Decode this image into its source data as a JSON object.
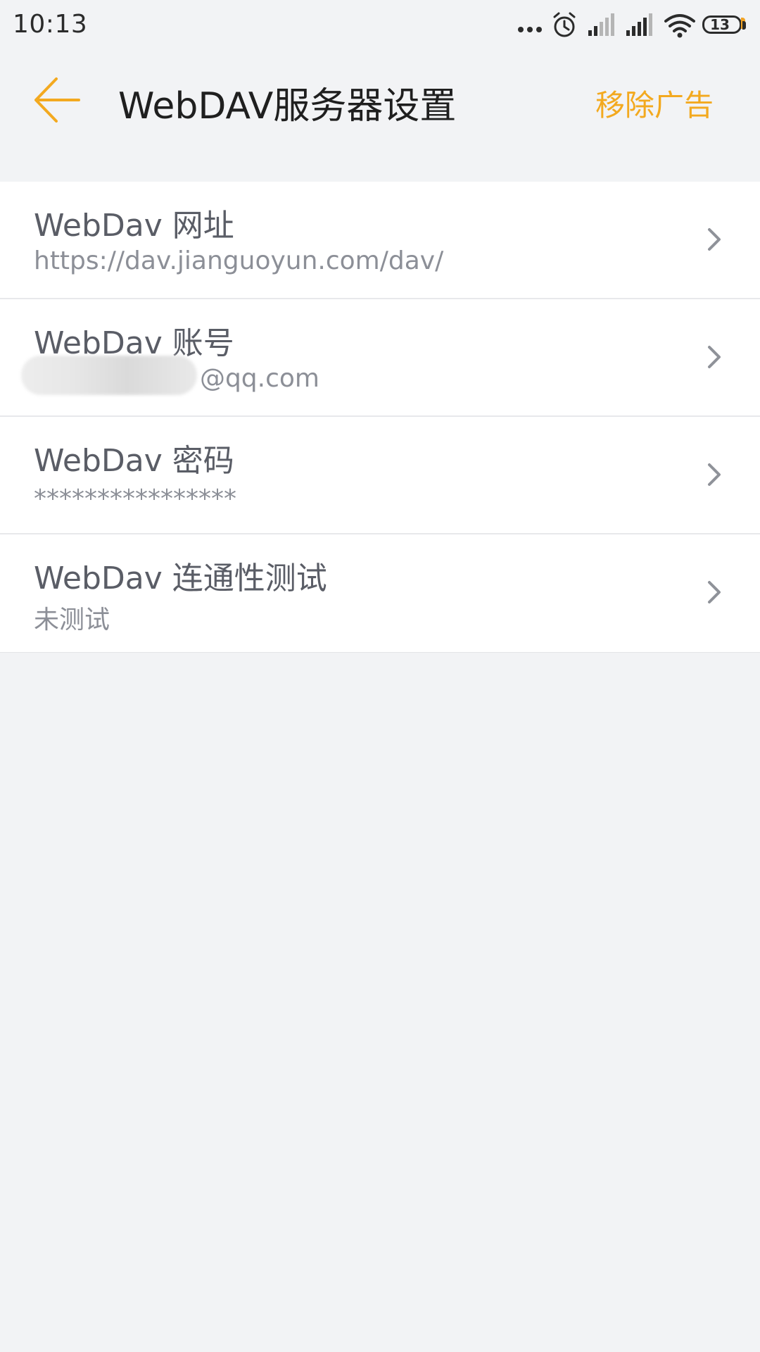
{
  "status_bar": {
    "time": "10:13",
    "battery": "13",
    "icons": [
      "more-dots-icon",
      "alarm-icon",
      "signal-icon",
      "signal-icon",
      "wifi-icon",
      "battery-icon"
    ]
  },
  "app_bar": {
    "back_icon": "arrow-left-icon",
    "title": "WebDAV服务器设置",
    "action_label": "移除广告",
    "accent_color": "#f3a91f"
  },
  "settings": [
    {
      "title": "WebDav 网址",
      "value": "https://dav.jianguoyun.com/dav/",
      "icon": "chevron-right-icon"
    },
    {
      "title": "WebDav 账号",
      "value": "@qq.com",
      "icon": "chevron-right-icon"
    },
    {
      "title": "WebDav 密码",
      "value": "****************",
      "icon": "chevron-right-icon"
    },
    {
      "title": "WebDav 连通性测试",
      "value": "未测试",
      "icon": "chevron-right-icon"
    }
  ]
}
